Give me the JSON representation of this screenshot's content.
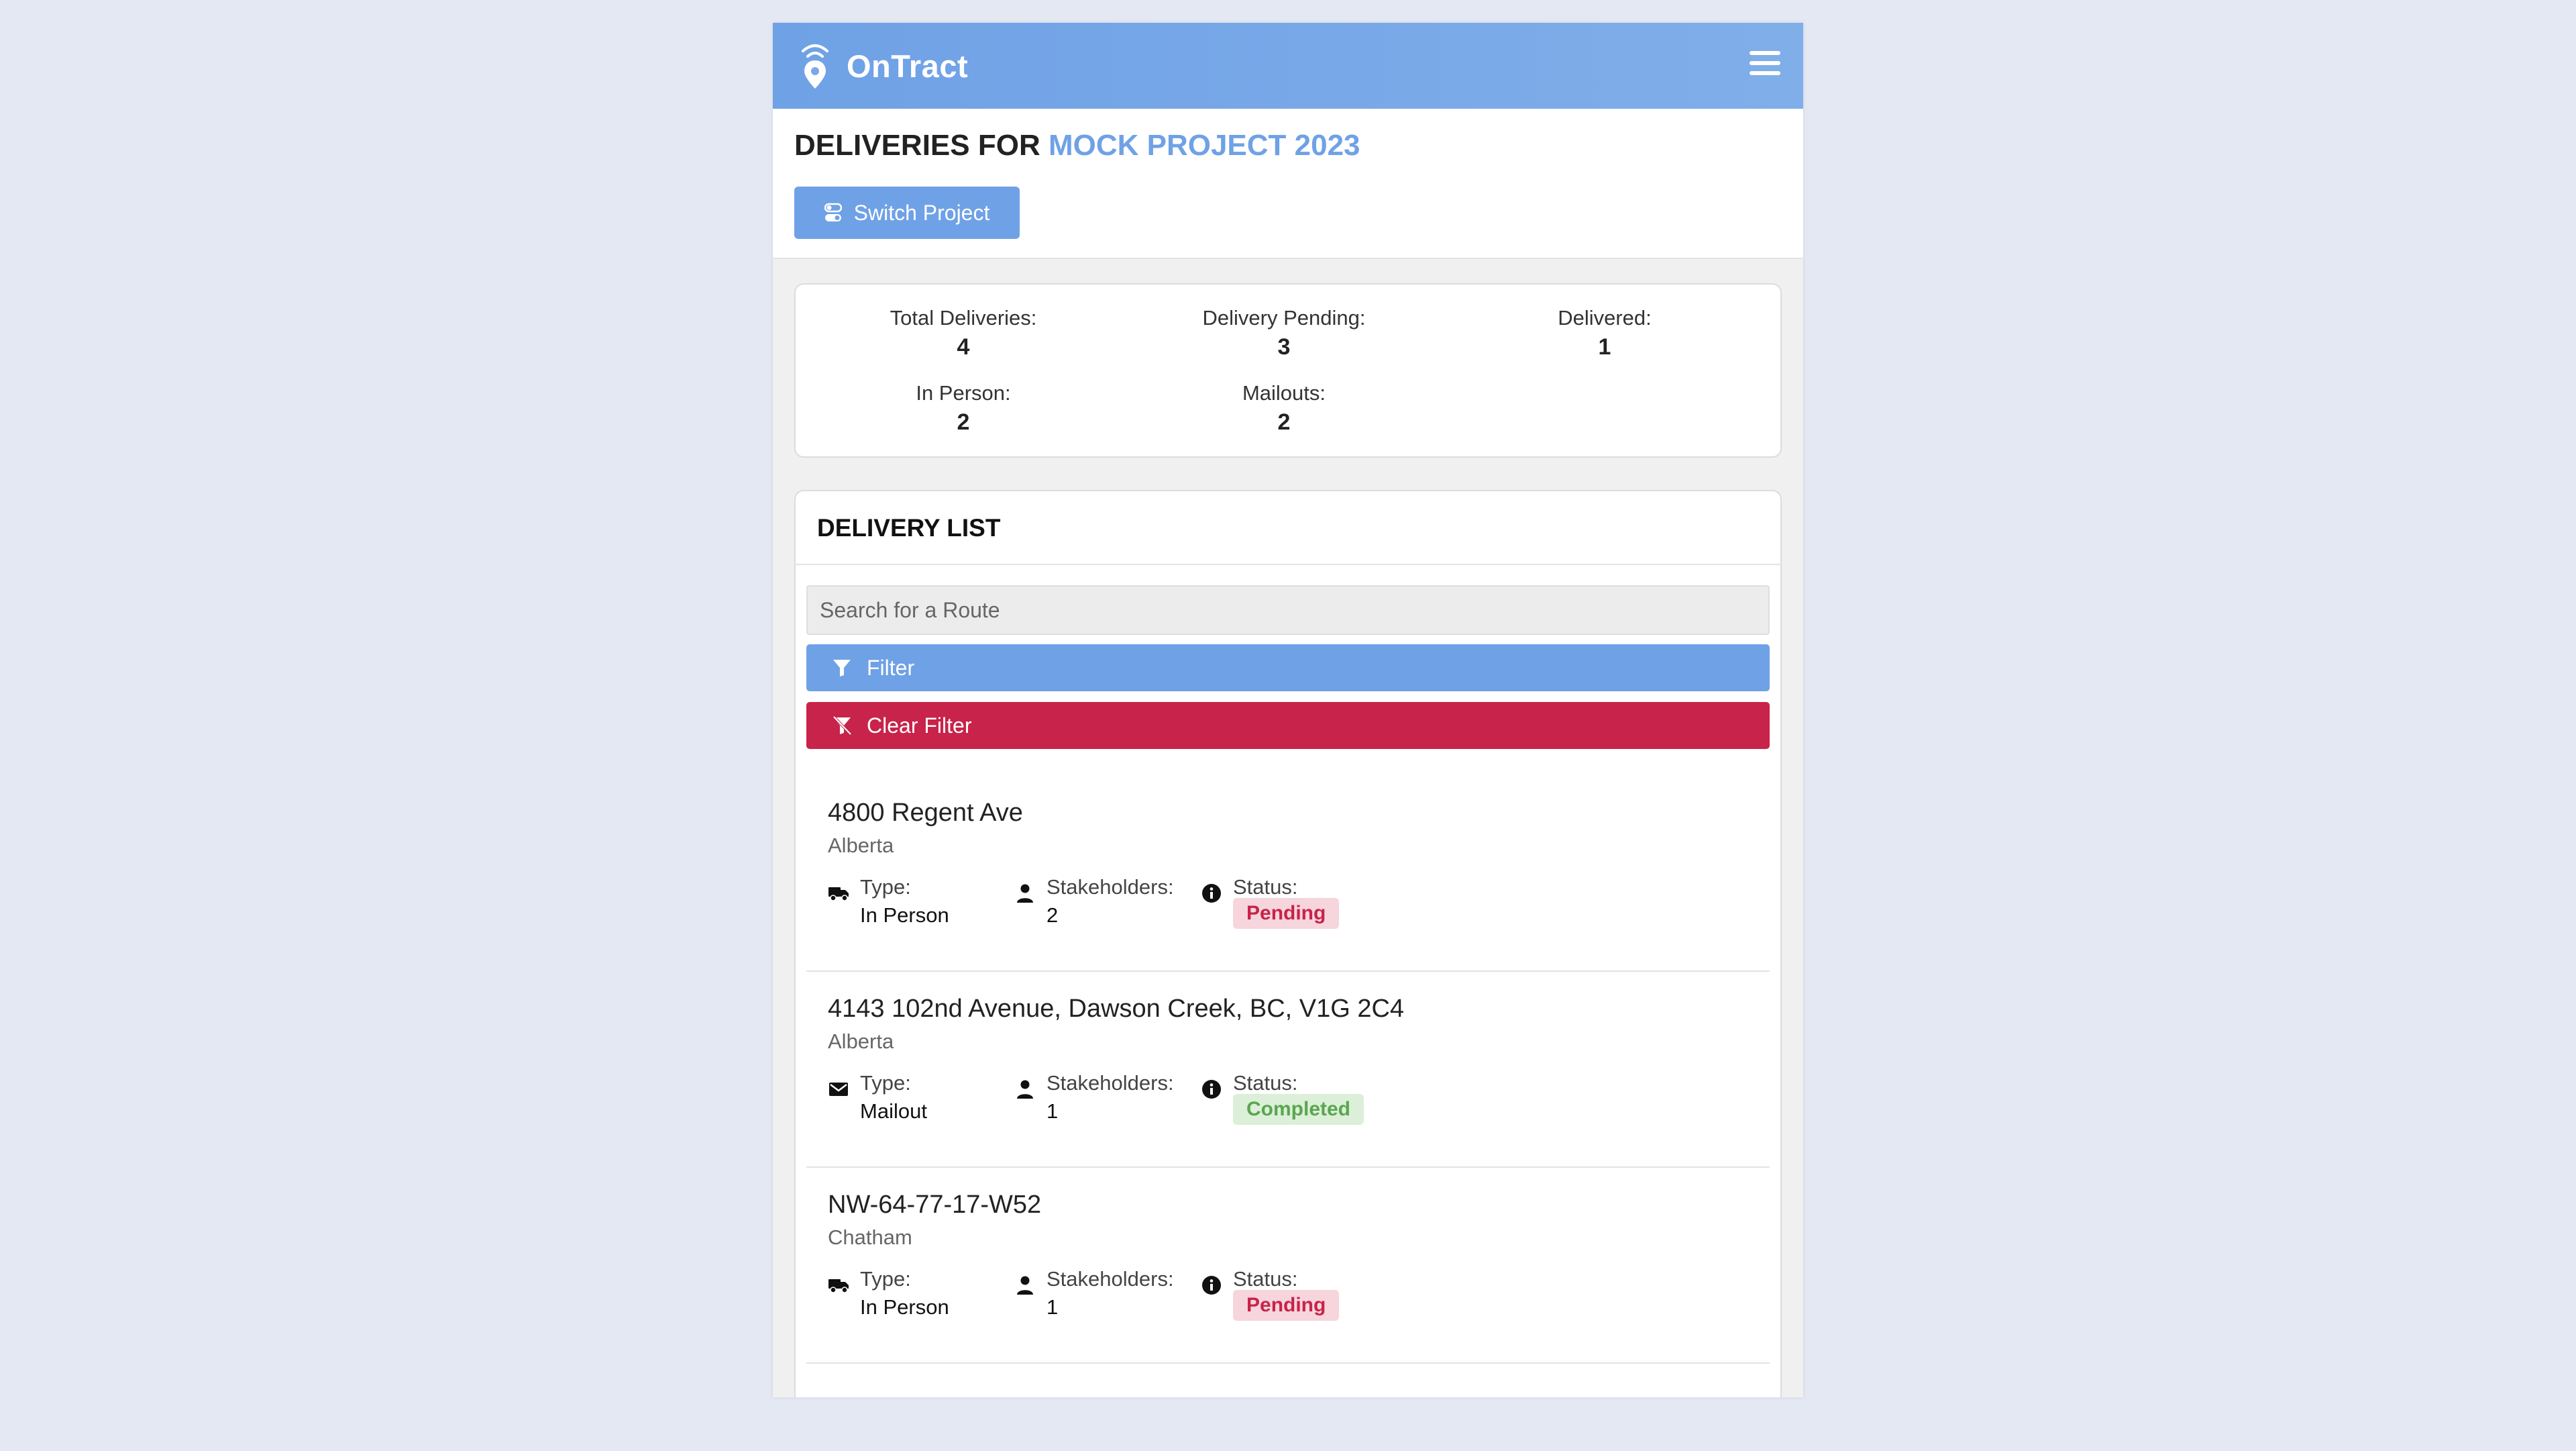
{
  "app": {
    "brand": "OnTract"
  },
  "header": {
    "title_prefix": "DELIVERIES FOR",
    "project_name": "MOCK PROJECT 2023",
    "switch_button": "Switch Project"
  },
  "stats": {
    "total_label": "Total Deliveries:",
    "total_value": "4",
    "pending_label": "Delivery Pending:",
    "pending_value": "3",
    "delivered_label": "Delivered:",
    "delivered_value": "1",
    "in_person_label": "In Person:",
    "in_person_value": "2",
    "mailouts_label": "Mailouts:",
    "mailouts_value": "2"
  },
  "list": {
    "title": "DELIVERY LIST",
    "search_placeholder": "Search for a Route",
    "filter_button": "Filter",
    "clear_filter_button": "Clear Filter",
    "type_label": "Type:",
    "stakeholders_label": "Stakeholders:",
    "status_label": "Status:",
    "items": [
      {
        "address": "4800 Regent Ave",
        "region": "Alberta",
        "type": "In Person",
        "type_icon": "truck-icon",
        "stakeholders": "2",
        "status": "Pending"
      },
      {
        "address": "4143 102nd Avenue, Dawson Creek, BC, V1G 2C4",
        "region": "Alberta",
        "type": "Mailout",
        "type_icon": "envelope-icon",
        "stakeholders": "1",
        "status": "Completed"
      },
      {
        "address": "NW-64-77-17-W52",
        "region": "Chatham",
        "type": "In Person",
        "type_icon": "truck-icon",
        "stakeholders": "1",
        "status": "Pending"
      }
    ]
  },
  "colors": {
    "accent": "#6fa1e6",
    "danger": "#c8234a",
    "pending_bg": "#f6d5dc",
    "completed_bg": "#dcefd8",
    "completed_text": "#5aa651",
    "page_bg": "#e4e8f2"
  }
}
